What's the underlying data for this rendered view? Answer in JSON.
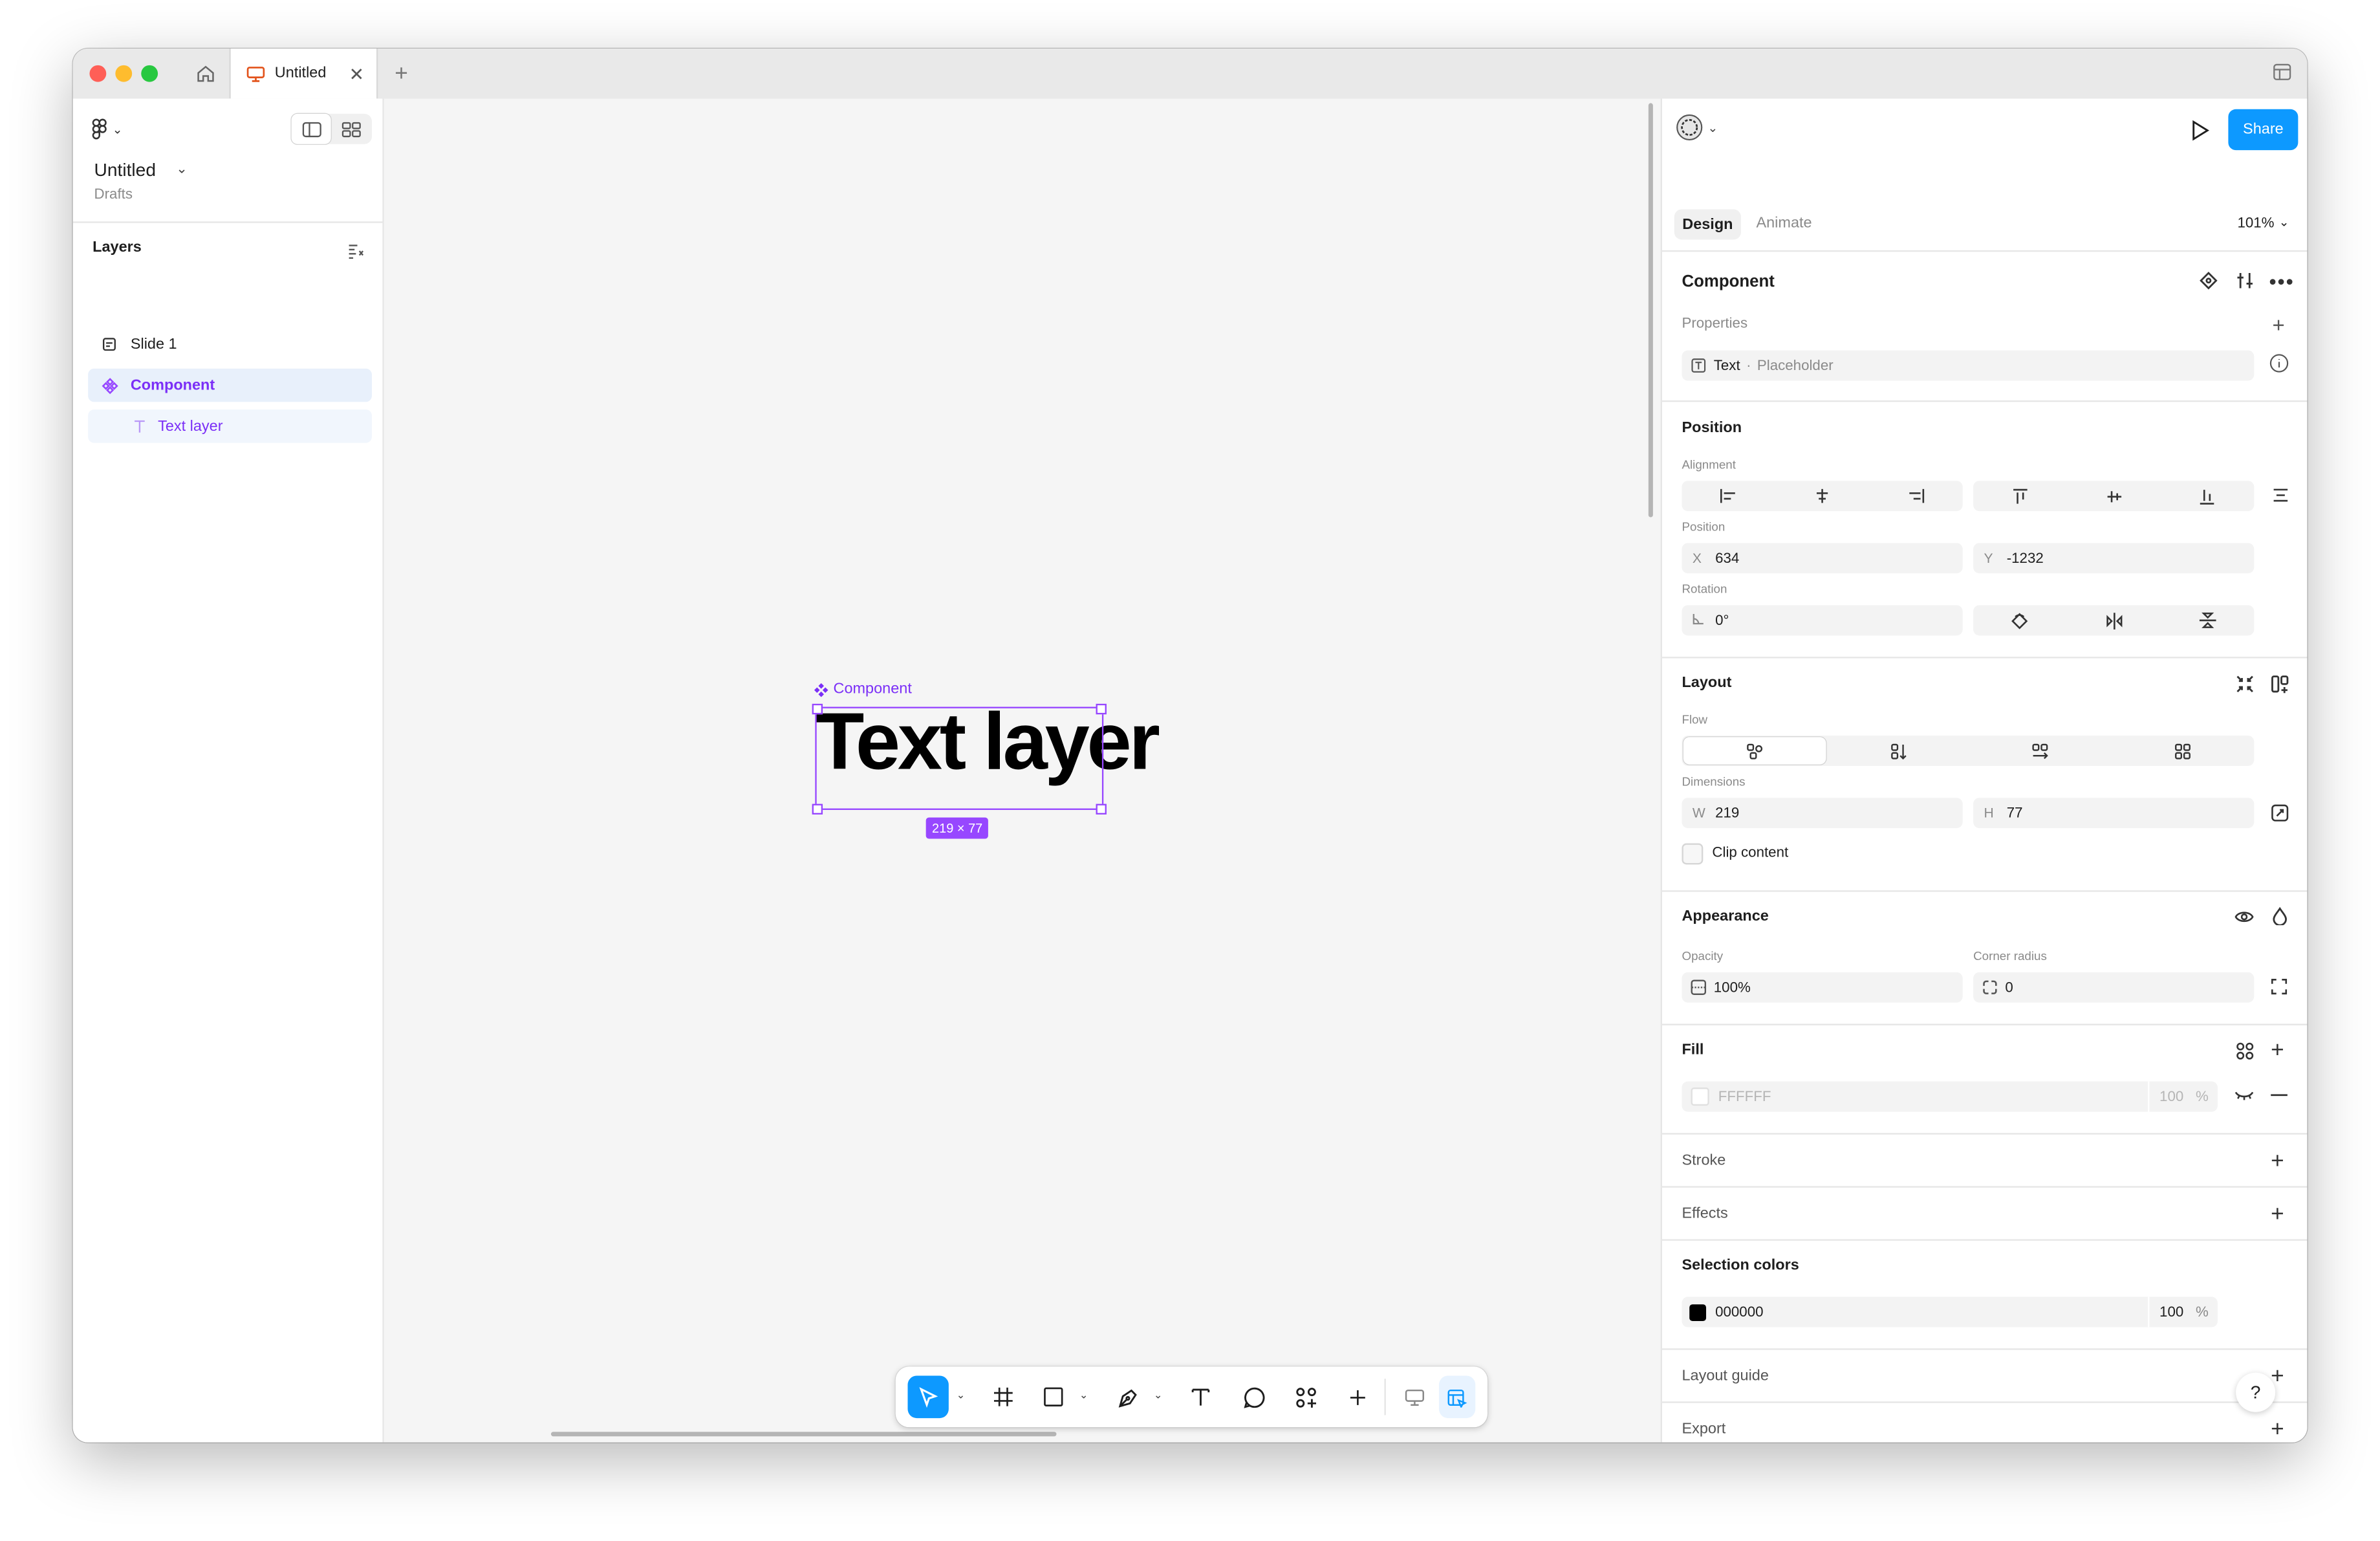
{
  "tabbar": {
    "tab_title": "Untitled",
    "new_tab": "+"
  },
  "left_panel": {
    "file_title": "Untitled",
    "file_location": "Drafts",
    "layers_title": "Layers",
    "layers": [
      {
        "label": "Slide 1",
        "icon": "slide-icon"
      },
      {
        "label": "Component",
        "icon": "component-icon"
      },
      {
        "label": "Text layer",
        "icon": "text-icon"
      }
    ]
  },
  "canvas": {
    "component_label": "Component",
    "text_content": "Text layer",
    "dimension_badge": "219 × 77"
  },
  "right_panel": {
    "tabs": {
      "design": "Design",
      "animate": "Animate"
    },
    "zoom": "101%",
    "share_label": "Share",
    "component": {
      "title": "Component",
      "properties_label": "Properties",
      "property_name": "Text",
      "property_separator": "·",
      "property_value": "Placeholder"
    },
    "position": {
      "title": "Position",
      "alignment_label": "Alignment",
      "position_label": "Position",
      "x_prefix": "X",
      "x_value": "634",
      "y_prefix": "Y",
      "y_value": "-1232",
      "rotation_label": "Rotation",
      "rotation_value": "0°"
    },
    "layout": {
      "title": "Layout",
      "flow_label": "Flow",
      "dimensions_label": "Dimensions",
      "w_prefix": "W",
      "w_value": "219",
      "h_prefix": "H",
      "h_value": "77",
      "clip_content_label": "Clip content"
    },
    "appearance": {
      "title": "Appearance",
      "opacity_label": "Opacity",
      "opacity_value": "100%",
      "corner_radius_label": "Corner radius",
      "corner_radius_value": "0"
    },
    "fill": {
      "title": "Fill",
      "color_hex": "FFFFFF",
      "opacity": "100",
      "percent": "%"
    },
    "stroke": {
      "title": "Stroke"
    },
    "effects": {
      "title": "Effects"
    },
    "selection_colors": {
      "title": "Selection colors",
      "color_hex": "000000",
      "opacity": "100",
      "percent": "%"
    },
    "layout_guide": {
      "title": "Layout guide"
    },
    "export": {
      "title": "Export"
    },
    "help_label": "?"
  },
  "colors": {
    "accent_blue": "#0d99ff",
    "component_purple": "#9747ff",
    "component_text_purple": "#7b2ff7"
  }
}
